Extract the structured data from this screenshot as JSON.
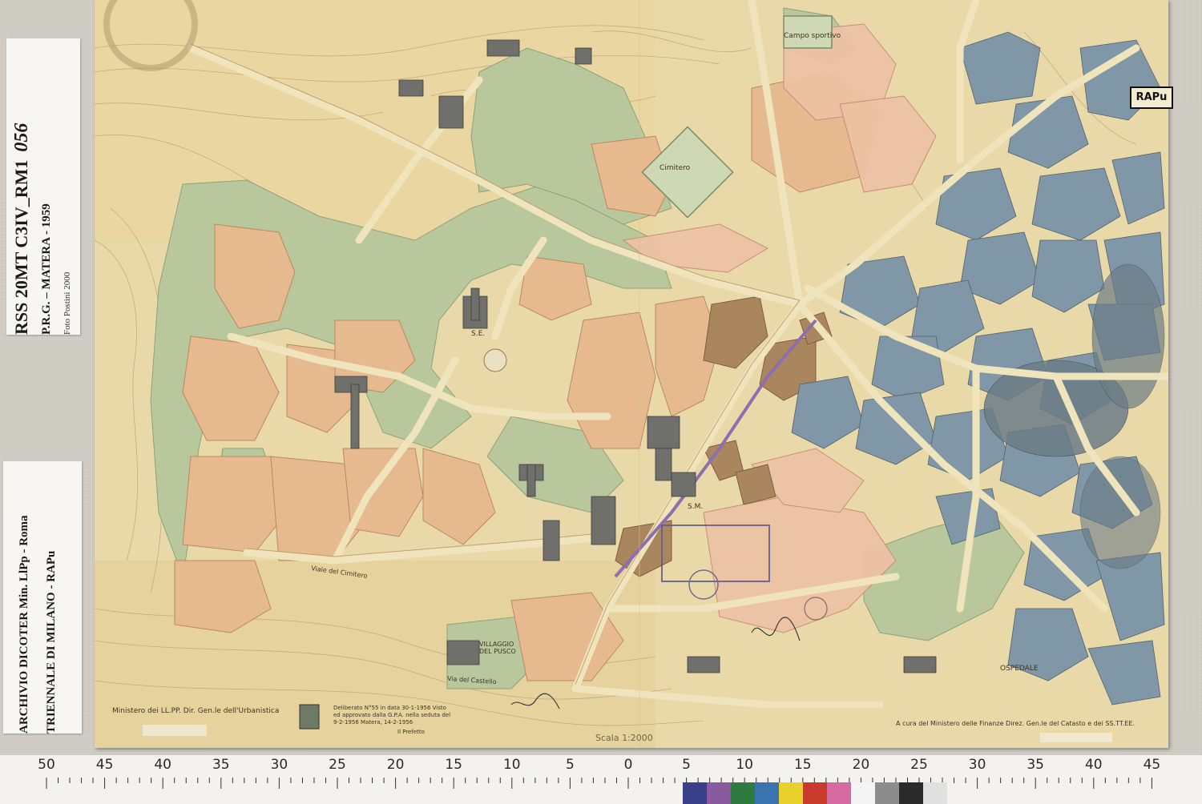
{
  "archive_label_top": {
    "code": "RSS 20MT C3IV_RM1",
    "number": "056",
    "plan": "P.R.G. – MATERA - 1959",
    "photo_credit": "Foto Postini 2000"
  },
  "archive_label_bottom": {
    "archive": "ARCHIVIO DICOTER Min. LlPp - Roma",
    "triennale": "TRIENNALE DI MILANO - RAPu"
  },
  "map": {
    "stamp": "RAPu",
    "ministry_caption": "Ministero dei LL.PP. Dir. Gen.le dell'Urbanistica",
    "approval_note": "Deliberato N°55 in data 30-1-1956 Visto ed approvato dalla G.P.A. nella seduta del 9-2-1956 Matera, 14-2-1956",
    "prefect": "Il Prefetto",
    "cadastre_caption": "A cura del Ministero delle Finanze Direz. Gen.le del Catasto e dei SS.TT.EE.",
    "scale": "Scala 1:2000",
    "labels": {
      "cimitero": "Cimitero",
      "campo_sportivo": "Campo sportivo",
      "se": "S.E.",
      "sm": "S.M.",
      "ospedale": "OSPEDALE",
      "villaggio": "VILLAGGIO DEL PUSCO",
      "viale_cimitero": "Viale del Cimitero",
      "via_castello": "Via del Castello"
    },
    "colors": {
      "paper": "#ead9a8",
      "green_zone": "#b9c79c",
      "orange_zone": "#e6b98e",
      "pink_zone": "#edc2a4",
      "brown_zone": "#a9865e",
      "blue_blocks": "#7f97a6",
      "buildings": "#6f6f6b"
    }
  },
  "ruler": {
    "ticks": [
      "50",
      "45",
      "40",
      "35",
      "30",
      "25",
      "20",
      "15",
      "10",
      "5",
      "0",
      "5",
      "10",
      "15",
      "20",
      "25",
      "30",
      "35",
      "40",
      "45"
    ],
    "swatches": [
      "#3a3f8a",
      "#8a5aa0",
      "#2f7a3e",
      "#3a73b0",
      "#e8d12a",
      "#c83a2c",
      "#d46aa0",
      "#f4f4f4",
      "#8c8c8c",
      "#2a2a2a",
      "#e0e0e0"
    ]
  }
}
